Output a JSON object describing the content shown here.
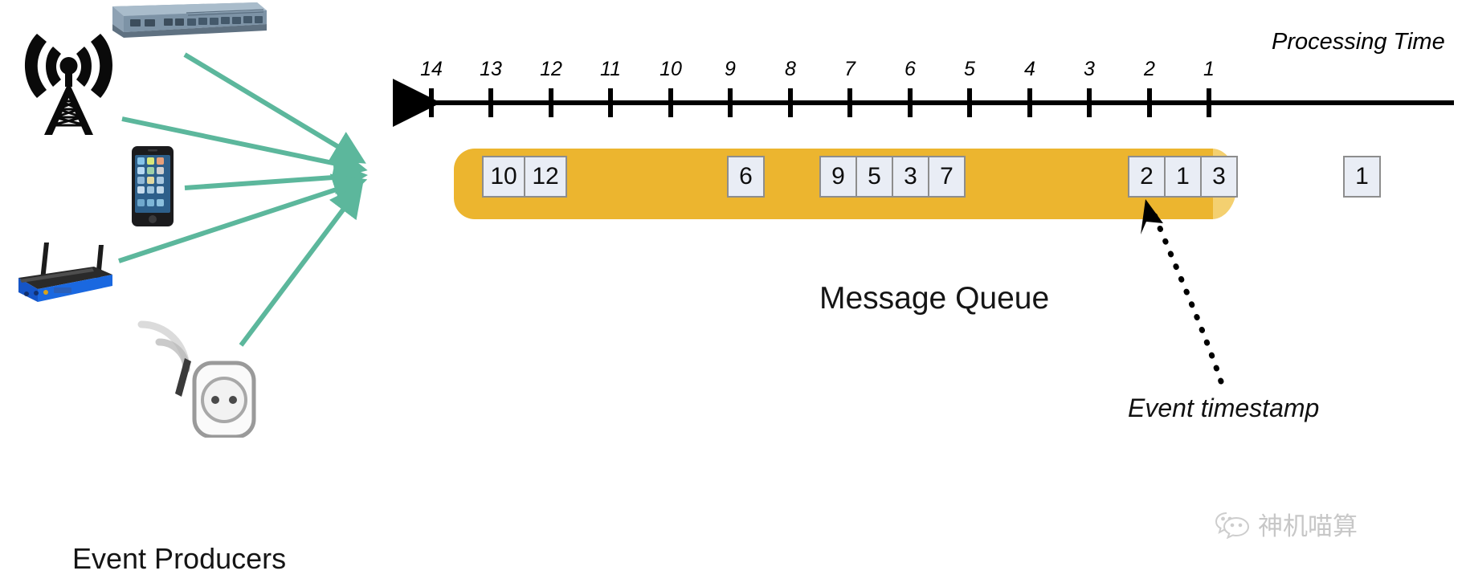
{
  "diagram": {
    "title": "Message Queue",
    "producers_label": "Event Producers",
    "timestamp_annotation": "Event timestamp",
    "colors": {
      "queue_fill": "#ecb52f",
      "queue_cap": "#f4d070",
      "message_box_fill": "#e9edf5",
      "message_box_border": "#8d8d8d",
      "arrow_green": "#5cb79c",
      "axis_black": "#000000"
    }
  },
  "timeline": {
    "axis_label": "Processing Time",
    "direction": "left",
    "ticks": [
      "14",
      "13",
      "12",
      "11",
      "10",
      "9",
      "8",
      "7",
      "6",
      "5",
      "4",
      "3",
      "2",
      "1"
    ]
  },
  "queue": {
    "groups": [
      {
        "name": "group-a",
        "messages": [
          "10",
          "12"
        ]
      },
      {
        "name": "group-b",
        "messages": [
          "6"
        ]
      },
      {
        "name": "group-c",
        "messages": [
          "9",
          "5",
          "3",
          "7"
        ]
      },
      {
        "name": "group-d",
        "messages": [
          "2",
          "1",
          "3"
        ]
      },
      {
        "name": "group-e",
        "messages": [
          "1"
        ]
      }
    ]
  },
  "producers": [
    {
      "name": "radio-tower",
      "icon": "radio-tower-icon"
    },
    {
      "name": "network-switch",
      "icon": "network-switch-icon"
    },
    {
      "name": "smartphone",
      "icon": "smartphone-icon"
    },
    {
      "name": "wifi-router",
      "icon": "wifi-router-icon"
    },
    {
      "name": "wireless-sensor",
      "icon": "wireless-sensor-icon"
    }
  ],
  "watermark": {
    "text": "神机喵算",
    "icon": "wechat-icon"
  }
}
